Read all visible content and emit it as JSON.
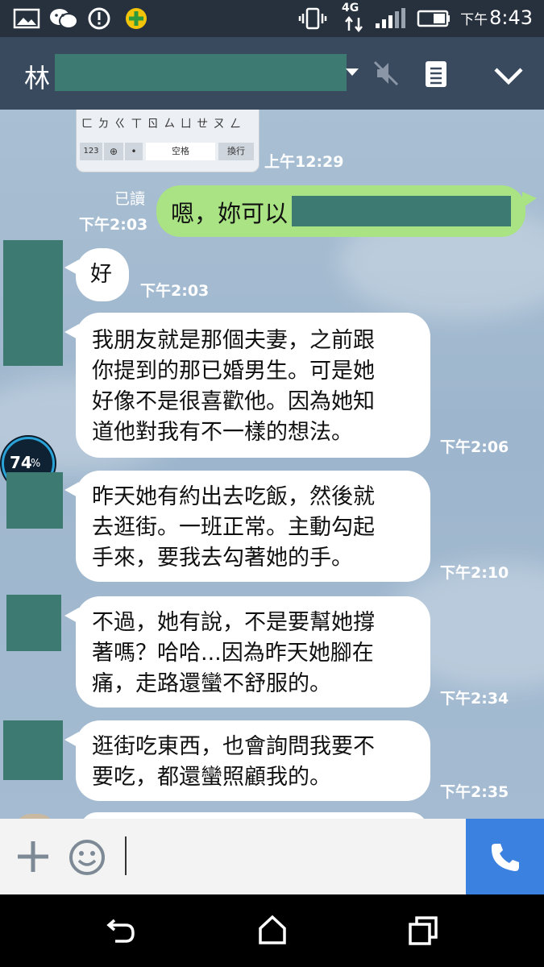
{
  "status_bar": {
    "network": "4G",
    "time_prefix": "下午",
    "time": "8:43"
  },
  "header": {
    "contact_name": "林"
  },
  "keyboard_thumb": {
    "row1": "ㄈ ㄉ ㄍ ㄒ ㄖ ㄙ ㄩ ㄝ ㄡ ㄥ",
    "key_123": "123",
    "key_space": "空格",
    "key_enter": "換行"
  },
  "messages": [
    {
      "type": "image",
      "time": "上午12:29"
    },
    {
      "type": "outgoing",
      "read": "已讀",
      "time": "下午2:03",
      "text": "嗯，妳可以"
    },
    {
      "type": "incoming",
      "time": "下午2:03",
      "lines": [
        "好"
      ]
    },
    {
      "type": "incoming",
      "time": "下午2:06",
      "lines": [
        "我朋友就是那個夫妻，之前跟",
        "你提到的那已婚男生。可是她",
        "好像不是很喜歡他。因為她知",
        "道他對我有不一樣的想法。"
      ]
    },
    {
      "type": "incoming",
      "time": "下午2:10",
      "lines": [
        "昨天她有約出去吃飯，然後就",
        "去逛街。一班正常。主動勾起",
        "手來，要我去勾著她的手。"
      ]
    },
    {
      "type": "incoming",
      "time": "下午2:34",
      "lines": [
        "不過，她有說，不是要幫她撐",
        "著嗎？哈哈...因為昨天她腳在",
        "痛，走路還蠻不舒服的。"
      ]
    },
    {
      "type": "incoming",
      "time": "下午2:35",
      "lines": [
        "逛街吃東西，也會詢問我要不",
        "要吃，都還蠻照顧我的。"
      ]
    }
  ],
  "overlay_widget": {
    "percent": "74",
    "unit": "%"
  },
  "colors": {
    "header": "#3a4a5e",
    "outgoing_bubble": "#a9e383",
    "call_button": "#3b82e0"
  }
}
